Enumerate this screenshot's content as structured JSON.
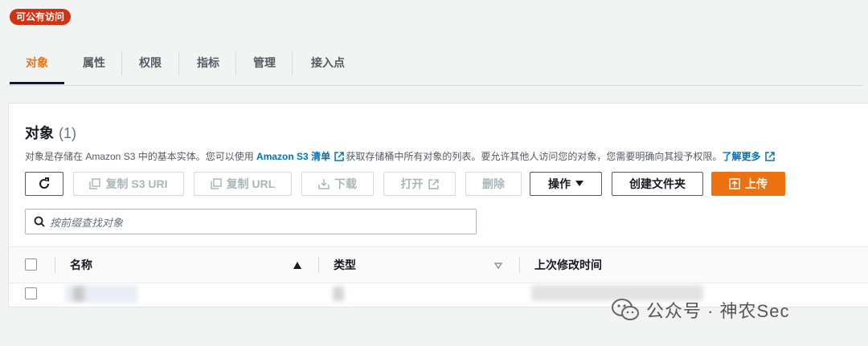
{
  "badge": "可公有访问",
  "tabs": [
    "对象",
    "属性",
    "权限",
    "指标",
    "管理",
    "接入点"
  ],
  "panel": {
    "title": "对象",
    "count": "(1)",
    "desc_1": "对象是存储在 Amazon S3 中的基本实体。您可以使用",
    "desc_link_1": "Amazon S3 清单",
    "desc_2": "获取存储桶中所有对象的列表。要允许其他人访问您的对象，您需要明确向其授予权限。",
    "desc_link_2": "了解更多"
  },
  "toolbar": {
    "copy_s3_uri": "复制 S3 URI",
    "copy_url": "复制 URL",
    "download": "下载",
    "open": "打开",
    "delete": "删除",
    "actions": "操作",
    "create_folder": "创建文件夹",
    "upload": "上传"
  },
  "search": {
    "placeholder": "按前缀查找对象"
  },
  "table": {
    "headers": {
      "name": "名称",
      "type": "类型",
      "last_modified": "上次修改时间"
    }
  },
  "watermark": "公众号 · 神农Sec",
  "colors": {
    "accent": "#ec7211",
    "badge": "#d13212",
    "link": "#0073bb"
  }
}
